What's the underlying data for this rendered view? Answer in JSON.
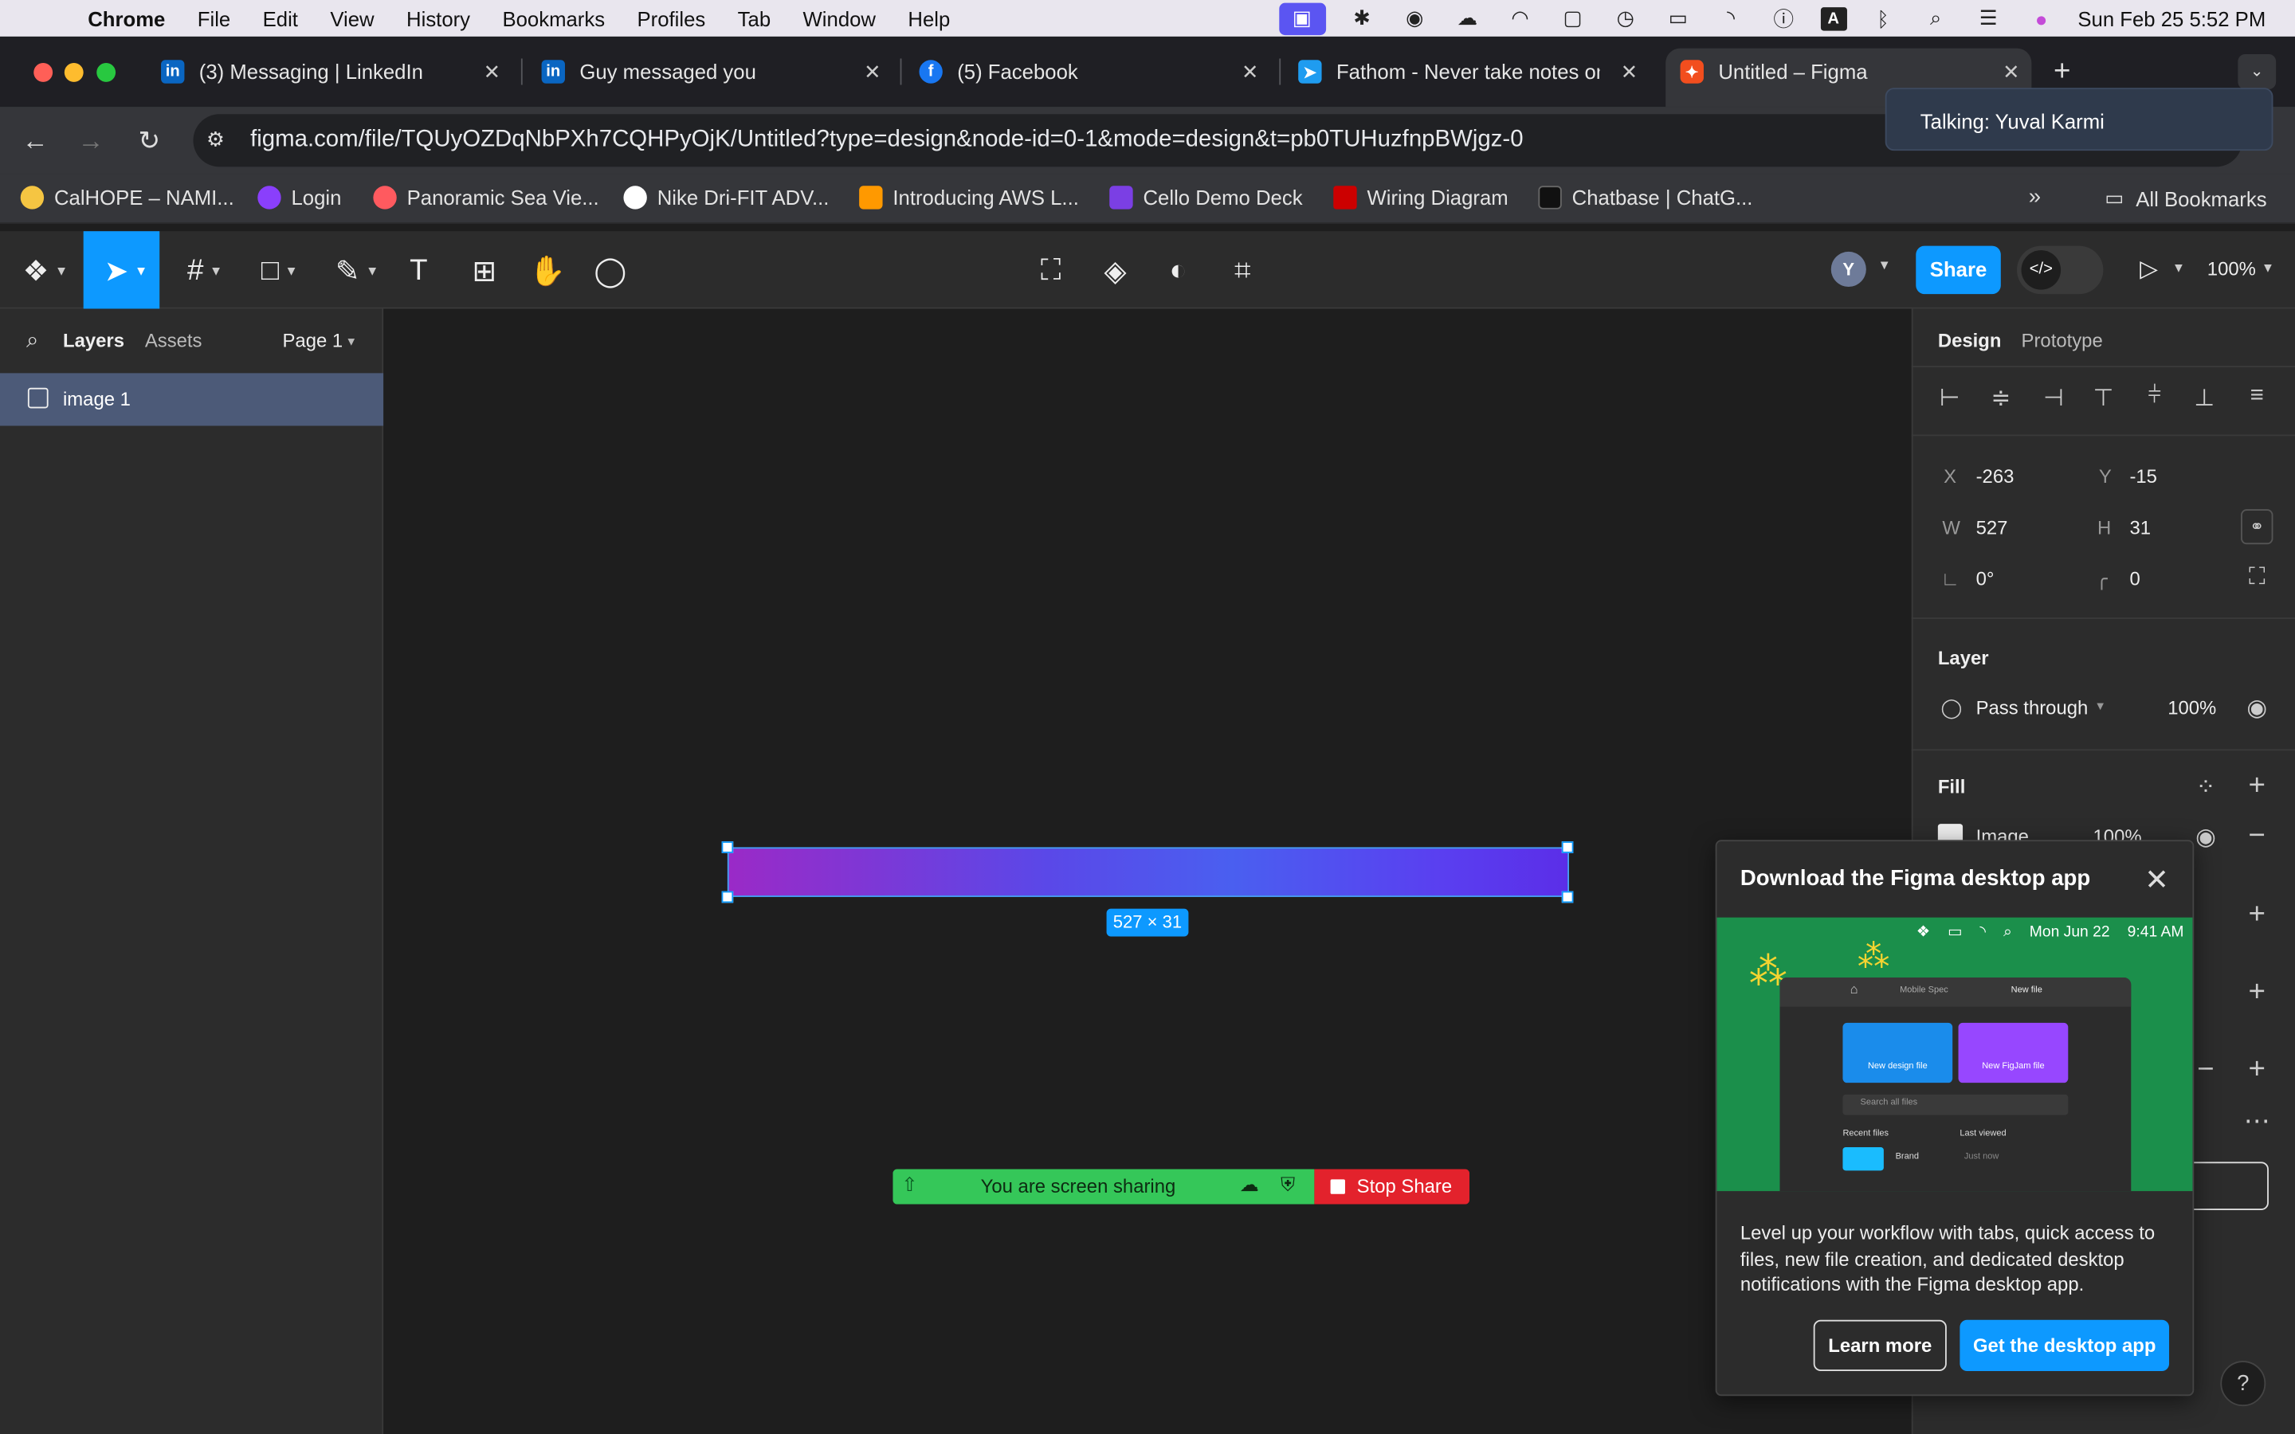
{
  "menubar": {
    "app": "Chrome",
    "items": [
      "File",
      "Edit",
      "View",
      "History",
      "Bookmarks",
      "Profiles",
      "Tab",
      "Window",
      "Help"
    ],
    "datetime": "Sun Feb 25  5:52 PM"
  },
  "tabs": [
    {
      "title": "(3) Messaging | LinkedIn",
      "icon": "linkedin-icon",
      "color": "#0a66c2"
    },
    {
      "title": "Guy messaged you",
      "icon": "linkedin-icon",
      "color": "#0a66c2"
    },
    {
      "title": "(5) Facebook",
      "icon": "facebook-icon",
      "color": "#1877f2"
    },
    {
      "title": "Fathom - Never take notes on",
      "icon": "fathom-icon",
      "color": "#1f9cf0"
    },
    {
      "title": "Untitled – Figma",
      "icon": "figma-icon",
      "color": "#f24e1e"
    }
  ],
  "address": {
    "url": "figma.com/file/TQUyOZDqNbPXh7CQHPyOjK/Untitled?type=design&node-id=0-1&mode=design&t=pb0TUHuzfnpBWjgz-0"
  },
  "talking": "Talking: Yuval Karmi",
  "bookmarks": [
    {
      "label": "CalHOPE – NAMI...",
      "color": "#f5c542"
    },
    {
      "label": "Login",
      "color": "#8a3ffc"
    },
    {
      "label": "Panoramic Sea Vie...",
      "color": "#ff5a5f"
    },
    {
      "label": "Nike Dri-FIT ADV...",
      "color": "#ffffff"
    },
    {
      "label": "Introducing AWS L...",
      "color": "#ff9900"
    },
    {
      "label": "Cello Demo Deck",
      "color": "#7b3fe4"
    },
    {
      "label": "Wiring Diagram",
      "color": "#cc0000"
    },
    {
      "label": "Chatbase | ChatG...",
      "color": "#111111"
    }
  ],
  "all_bookmarks": "All Bookmarks",
  "toolbar": {
    "share": "Share",
    "avatar_initial": "Y",
    "zoom": "100%"
  },
  "layers": {
    "tab_layers": "Layers",
    "tab_assets": "Assets",
    "page": "Page 1",
    "items": [
      "image 1"
    ]
  },
  "canvas": {
    "dimension_label": "527 × 31",
    "gradient_colors": [
      "#9a2ac7",
      "#4a5ff0",
      "#5b2ee8"
    ],
    "screenshare_text": "You are screen sharing",
    "stop_share": "Stop Share"
  },
  "design": {
    "tab_design": "Design",
    "tab_prototype": "Prototype",
    "x_label": "X",
    "x": "-263",
    "y_label": "Y",
    "y": "-15",
    "w_label": "W",
    "w": "527",
    "h_label": "H",
    "h": "31",
    "rotation": "0°",
    "radius": "0",
    "layer_title": "Layer",
    "blend": "Pass through",
    "opacity": "100%",
    "fill_title": "Fill",
    "fill_type": "Image",
    "fill_opacity": "100%"
  },
  "popup": {
    "title": "Download the Figma desktop app",
    "promo_date": "Mon Jun 22",
    "promo_time": "9:41 AM",
    "tab1": "Mobile Spec",
    "tab2": "New file",
    "card1": "New design file",
    "card2": "New FigJam file",
    "search": "Search all files",
    "recent": "Recent files",
    "last_viewed": "Last viewed",
    "file_name": "Brand",
    "file_time": "Just now",
    "description": "Level up your workflow with tabs, quick access to files, new file creation, and dedicated desktop notifications with the Figma desktop app.",
    "learn_more": "Learn more",
    "get_app": "Get the desktop app"
  },
  "help": "?",
  "colors": {
    "accent": "#0d99ff",
    "share_green": "#35c759",
    "stop_red": "#e3222c"
  }
}
